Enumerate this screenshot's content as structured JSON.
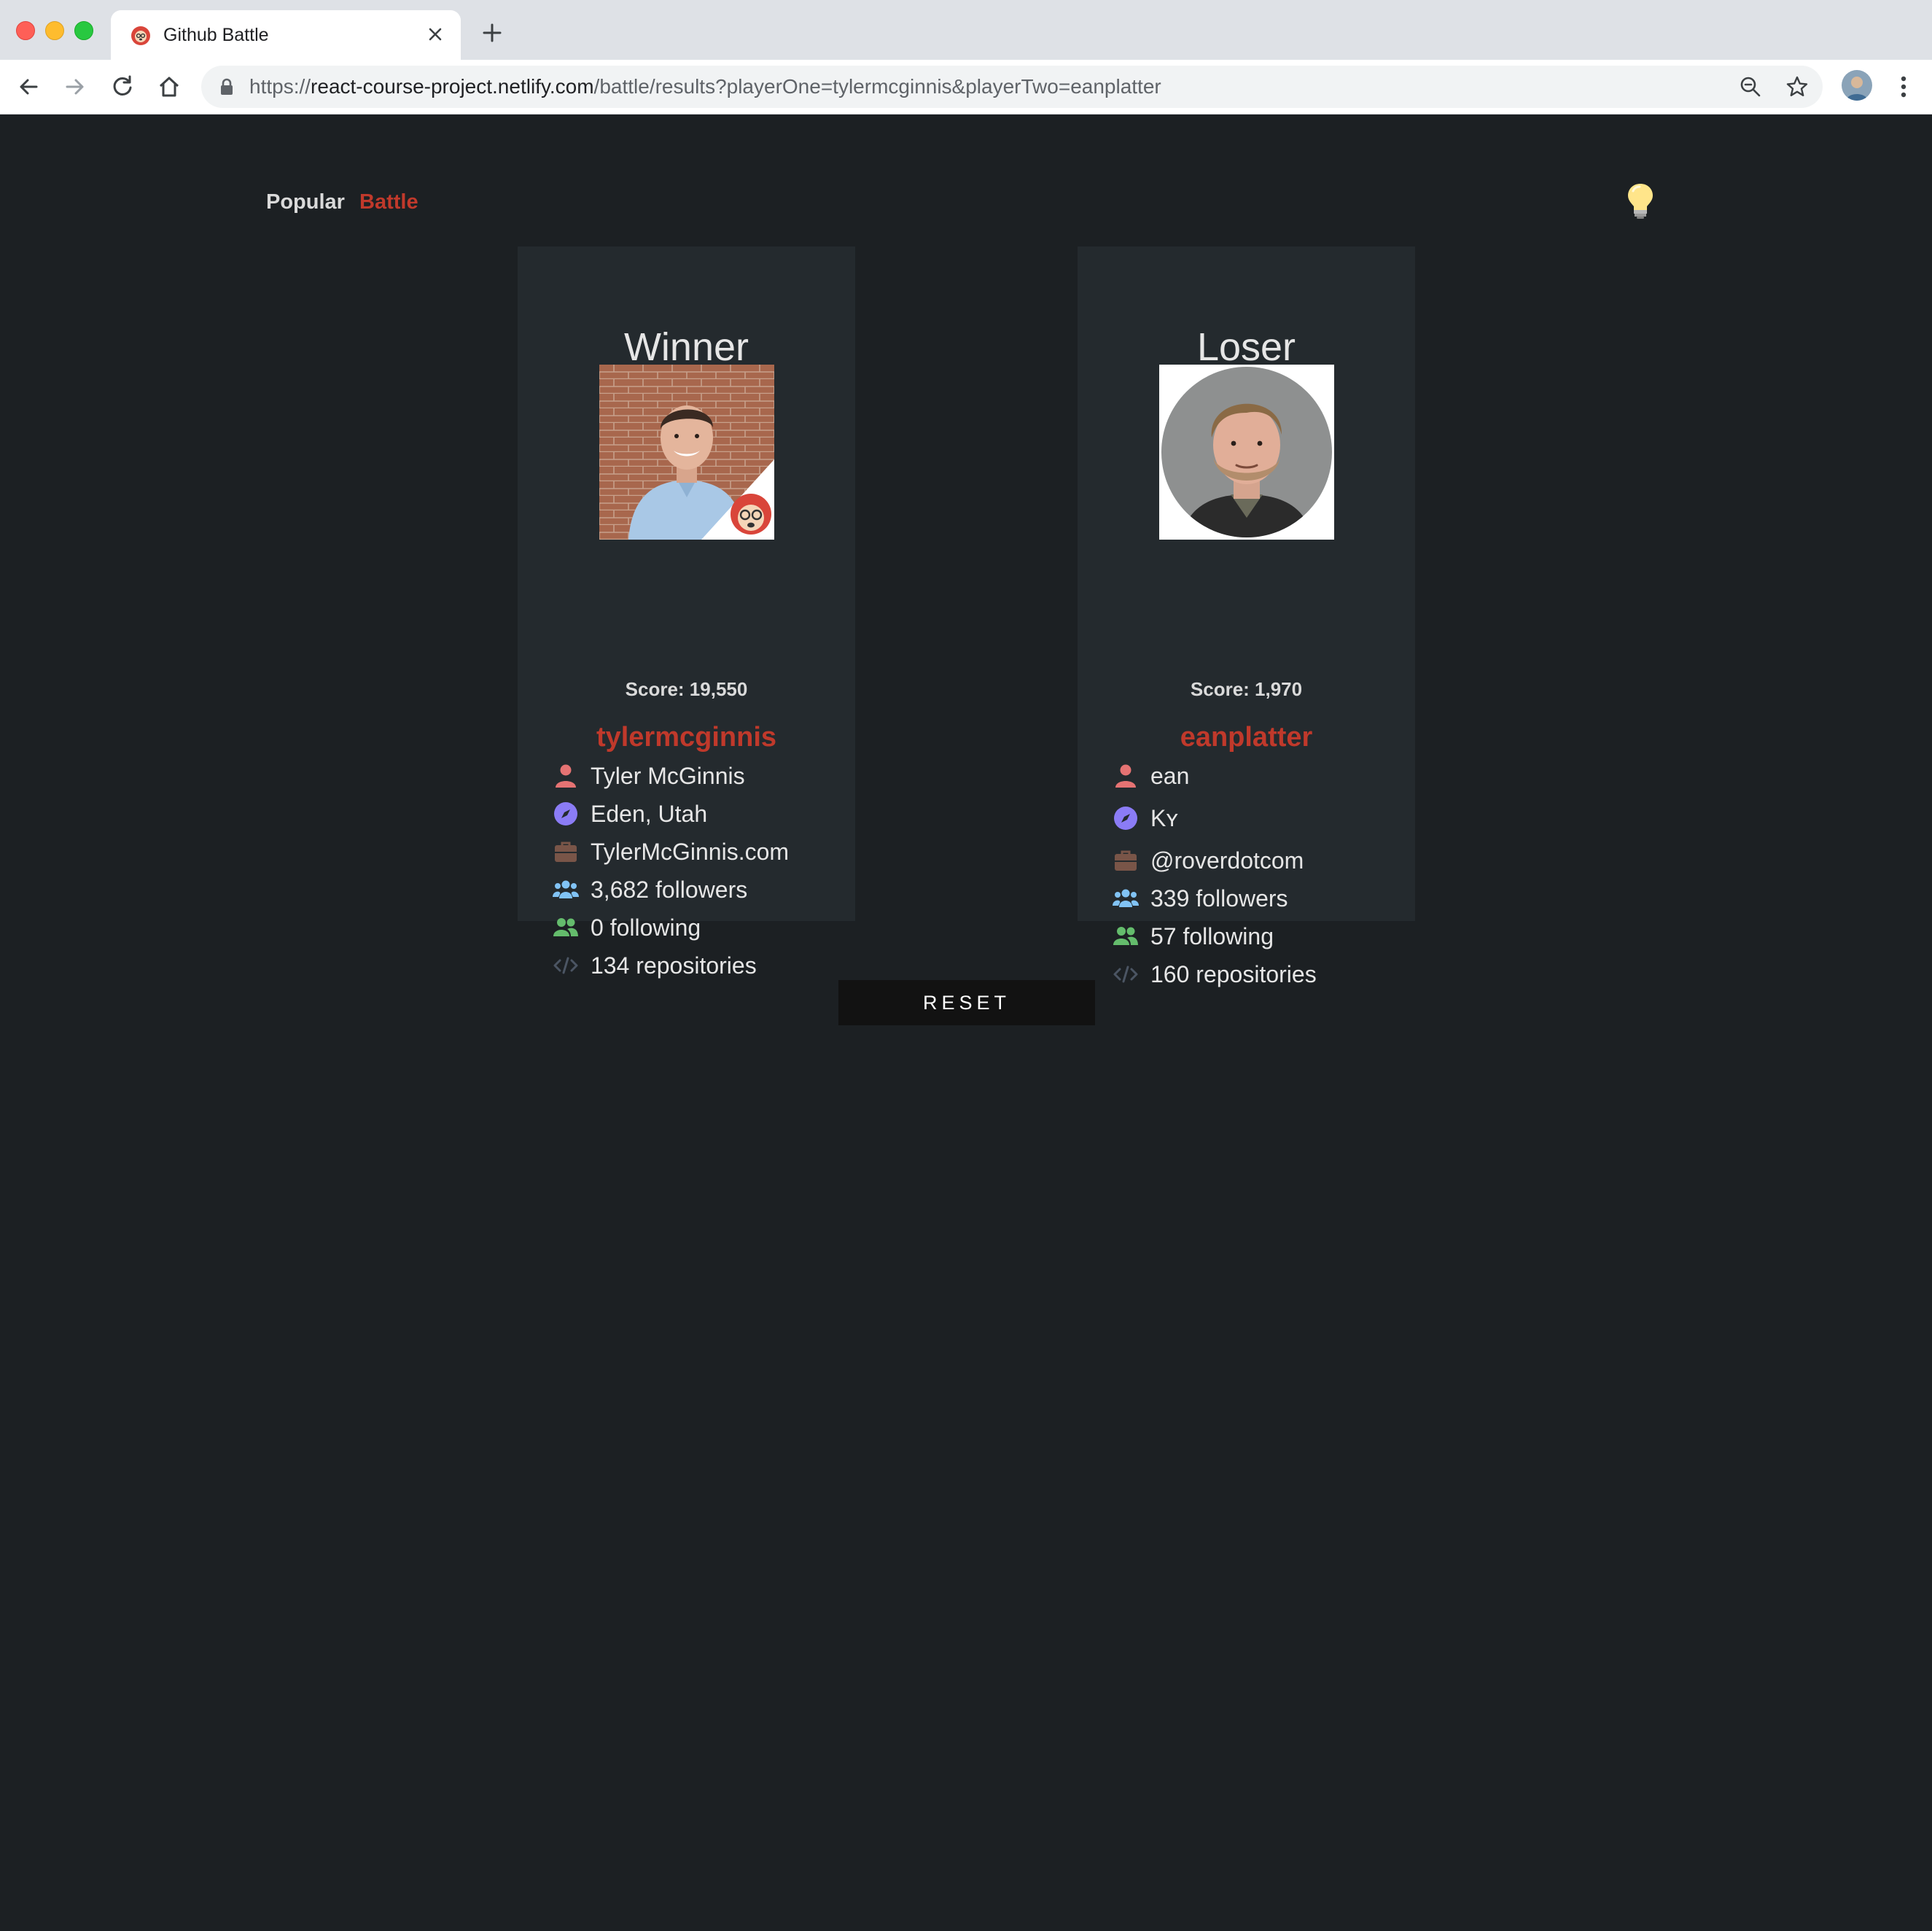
{
  "browser": {
    "tab_title": "Github Battle",
    "url_scheme": "https://",
    "url_host": "react-course-project.netlify.com",
    "url_path": "/battle/results?playerOne=tylermcginnis&playerTwo=eanplatter"
  },
  "nav": {
    "popular_label": "Popular",
    "battle_label": "Battle"
  },
  "players": [
    {
      "heading": "Winner",
      "score": "Score: 19,550",
      "login": "tylermcginnis",
      "name": "Tyler McGinnis",
      "location": "Eden, Utah",
      "company": "TylerMcGinnis.com",
      "followers": "3,682 followers",
      "following": "0 following",
      "repositories": "134 repositories"
    },
    {
      "heading": "Loser",
      "score": "Score: 1,970",
      "login": "eanplatter",
      "name": "ean",
      "location": "Kʏ",
      "company": "@roverdotcom",
      "followers": "339 followers",
      "following": "57 following",
      "repositories": "160 repositories"
    }
  ],
  "reset_label": "RESET",
  "colors": {
    "background": "#1c2023",
    "card": "#242a2e",
    "accent": "#c0392b",
    "user_icon": "#e57373",
    "location_icon": "#8b7cf6",
    "company_icon": "#795548",
    "followers_icon": "#81c3f5",
    "following_icon": "#64bc6c",
    "code_icon": "#4b5563"
  }
}
